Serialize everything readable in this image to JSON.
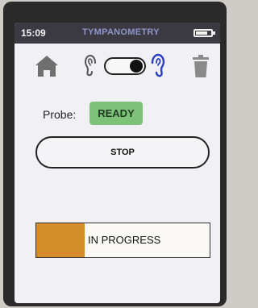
{
  "status_bar": {
    "time": "15:09",
    "title": "TYMPANOMETRY",
    "battery_icon": "battery-icon"
  },
  "toolbar": {
    "home_icon": "home-icon",
    "ear_left_icon": "ear-icon",
    "ear_right_icon": "ear-icon",
    "trash_icon": "trash-icon",
    "ear_toggle_selected": "right"
  },
  "probe": {
    "label": "Probe:",
    "status": "READY"
  },
  "stop_button": {
    "label": "STOP"
  },
  "progress": {
    "label": "IN PROGRESS",
    "fraction": 0.28
  },
  "colors": {
    "status_bar_bg": "#3b3942",
    "ready_green": "#7ec27a",
    "progress_orange": "#d48b29",
    "right_ear_blue": "#2a3fbf",
    "icon_gray": "#707070"
  }
}
